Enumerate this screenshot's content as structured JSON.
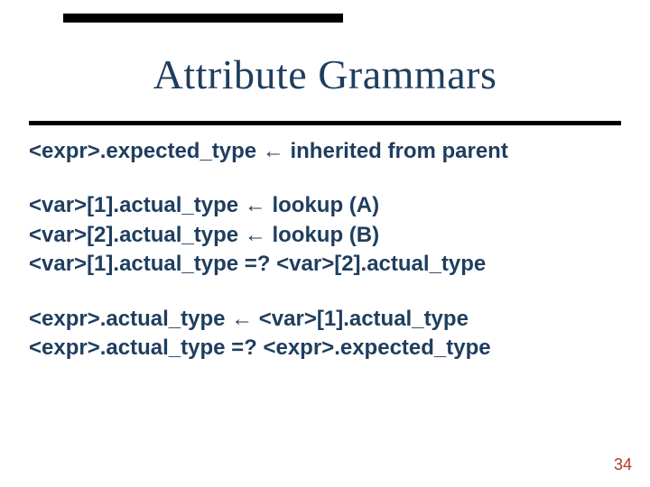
{
  "title": "Attribute Grammars",
  "lines": {
    "l1": "<expr>.expected_type ← inherited from parent",
    "l2": "<var>[1].actual_type ← lookup (A)",
    "l3": "<var>[2].actual_type ← lookup (B)",
    "l4": "<var>[1].actual_type =? <var>[2].actual_type",
    "l5": "<expr>.actual_type ← <var>[1].actual_type",
    "l6": "<expr>.actual_type =? <expr>.expected_type"
  },
  "page_number": "34"
}
